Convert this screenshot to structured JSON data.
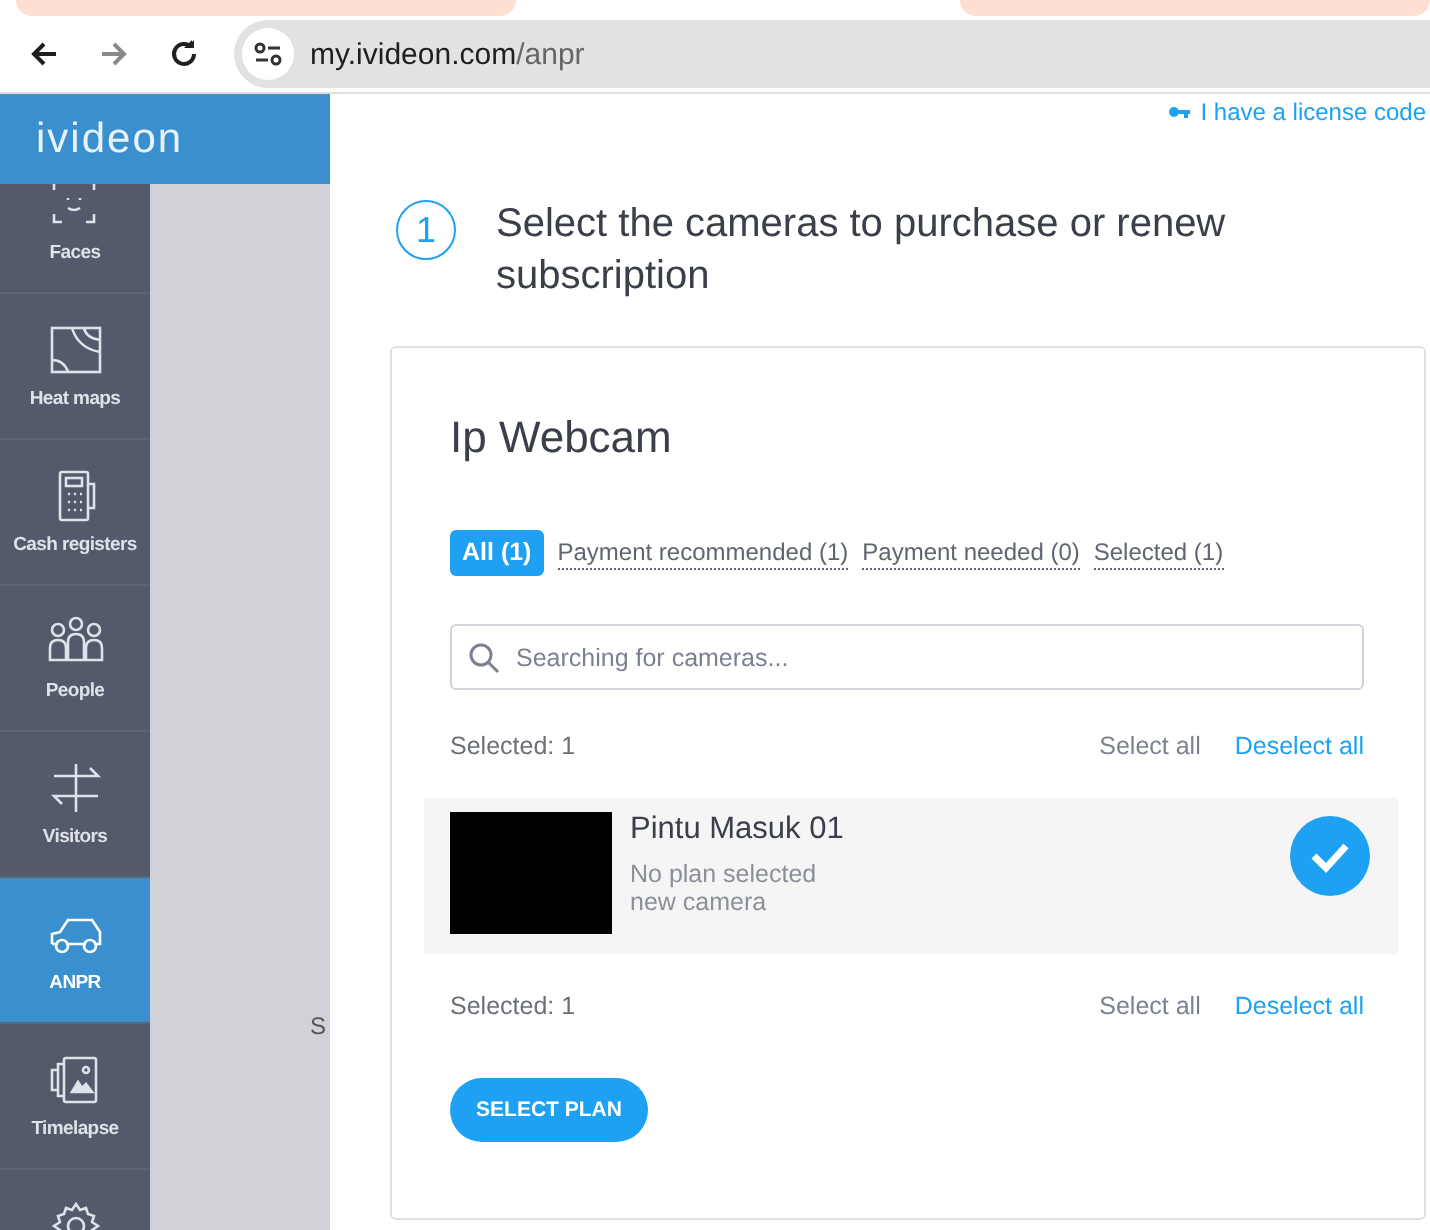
{
  "browser": {
    "url_host": "my.ivideon.com",
    "url_path": "/anpr"
  },
  "logo": "ivideon",
  "sidebar": {
    "items": [
      {
        "kind": "faces",
        "label": "Faces",
        "selected": false
      },
      {
        "kind": "heatmap",
        "label": "Heat maps",
        "selected": false
      },
      {
        "kind": "register",
        "label": "Cash registers",
        "selected": false
      },
      {
        "kind": "people",
        "label": "People",
        "selected": false
      },
      {
        "kind": "visitors",
        "label": "Visitors",
        "selected": false
      },
      {
        "kind": "car",
        "label": "ANPR",
        "selected": true
      },
      {
        "kind": "timelapse",
        "label": "Timelapse",
        "selected": false
      },
      {
        "kind": "settings",
        "selected": false
      }
    ]
  },
  "background_text": "S",
  "license_link": "I have a license code",
  "step": {
    "number": "1",
    "title": "Select the cameras to purchase or renew subscription"
  },
  "card": {
    "title": "Ip Webcam",
    "filters": [
      {
        "label": "All (1)",
        "selected": true
      },
      {
        "label": "Payment recommended (1)",
        "selected": false
      },
      {
        "label": "Payment needed (0)",
        "selected": false
      },
      {
        "label": "Selected (1)",
        "selected": false
      }
    ],
    "search": {
      "placeholder": "Searching for cameras..."
    },
    "selection_bars": [
      {
        "count": "Selected: 1",
        "select_all": "Select all",
        "deselect_all": "Deselect all"
      },
      {
        "count": "Selected: 1",
        "select_all": "Select all",
        "deselect_all": "Deselect all"
      }
    ],
    "cameras": [
      {
        "name": "Pintu Masuk 01",
        "plan": "No plan selected",
        "note": "new camera",
        "selected": true
      }
    ],
    "button": "SELECT PLAN"
  }
}
